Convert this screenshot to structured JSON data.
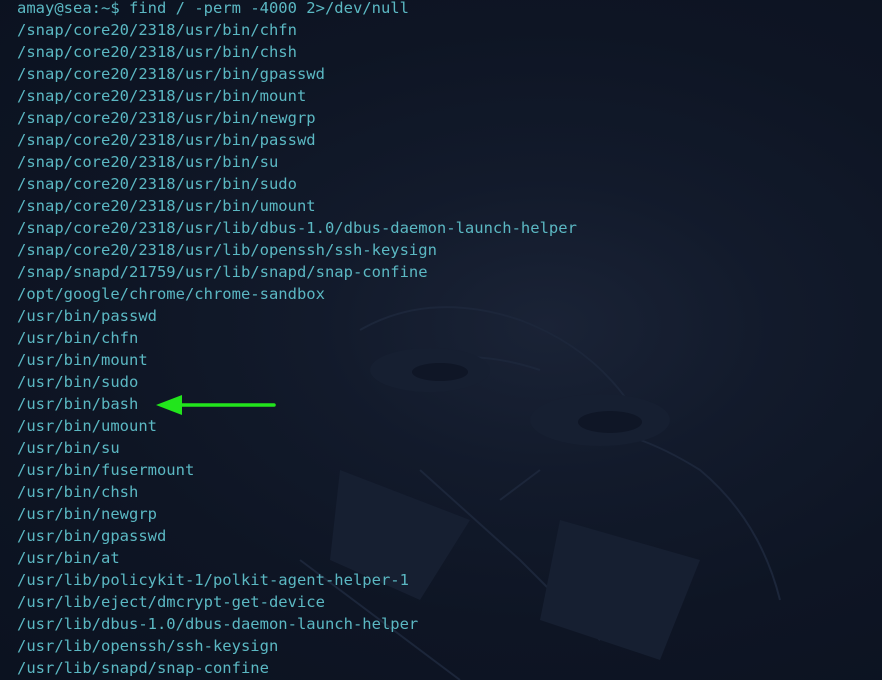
{
  "terminal": {
    "prompt": "amay@sea:~$",
    "command": "find / -perm -4000 2>/dev/null",
    "output": [
      "/snap/core20/2318/usr/bin/chfn",
      "/snap/core20/2318/usr/bin/chsh",
      "/snap/core20/2318/usr/bin/gpasswd",
      "/snap/core20/2318/usr/bin/mount",
      "/snap/core20/2318/usr/bin/newgrp",
      "/snap/core20/2318/usr/bin/passwd",
      "/snap/core20/2318/usr/bin/su",
      "/snap/core20/2318/usr/bin/sudo",
      "/snap/core20/2318/usr/bin/umount",
      "/snap/core20/2318/usr/lib/dbus-1.0/dbus-daemon-launch-helper",
      "/snap/core20/2318/usr/lib/openssh/ssh-keysign",
      "/snap/snapd/21759/usr/lib/snapd/snap-confine",
      "/opt/google/chrome/chrome-sandbox",
      "/usr/bin/passwd",
      "/usr/bin/chfn",
      "/usr/bin/mount",
      "/usr/bin/sudo",
      "/usr/bin/bash",
      "/usr/bin/umount",
      "/usr/bin/su",
      "/usr/bin/fusermount",
      "/usr/bin/chsh",
      "/usr/bin/newgrp",
      "/usr/bin/gpasswd",
      "/usr/bin/at",
      "/usr/lib/policykit-1/polkit-agent-helper-1",
      "/usr/lib/eject/dmcrypt-get-device",
      "/usr/lib/dbus-1.0/dbus-daemon-launch-helper",
      "/usr/lib/openssh/ssh-keysign",
      "/usr/lib/snapd/snap-confine"
    ]
  },
  "annotation": {
    "arrow_color": "#22e51c",
    "arrow_icon": "arrow-left-icon"
  },
  "colors": {
    "background": "#0d1422",
    "text": "#5bb8c3"
  }
}
